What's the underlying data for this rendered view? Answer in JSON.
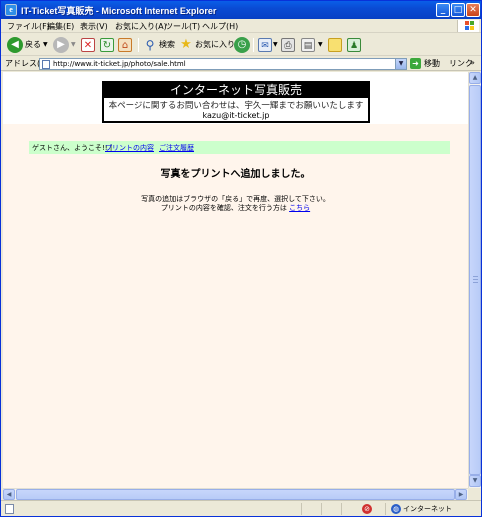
{
  "window": {
    "title": "IT-Ticket写真販売 - Microsoft Internet Explorer",
    "minimize_glyph": "_",
    "maximize_glyph": "□",
    "close_glyph": "✕"
  },
  "menu": {
    "items": [
      "ファイル(F)",
      "編集(E)",
      "表示(V)",
      "お気に入り(A)",
      "ツール(T)",
      "ヘルプ(H)"
    ]
  },
  "toolbar": {
    "back_label": "戻る",
    "search_label": "検索",
    "favorites_label": "お気に入り"
  },
  "address": {
    "label": "アドレス(D)",
    "url": "http://www.it-ticket.jp/photo/sale.html",
    "go_label": "移動",
    "links_label": "リンク",
    "links_chevron": "»"
  },
  "page": {
    "header_title": "インターネット写真販売",
    "header_note": "本ページに関するお問い合わせは、宇久一輝までお願いいたします",
    "header_email": "kazu@it-ticket.jp",
    "nav": {
      "greeting": "ゲストさん、ようこそ!! |",
      "link_print": "プリントの内容",
      "link_history": "ご注文履歴"
    },
    "message_heading": "写真をプリントへ追加しました。",
    "message_line1": "写真の追加はブラウザの「戻る」で再度、選択して下さい。",
    "message_line2_prefix": "プリントの内容を確認、注文を行う方は",
    "message_line2_link": "こちら"
  },
  "status": {
    "zone": "インターネット"
  },
  "colors": {
    "titlebar": "#0a4bd4",
    "content_bg": "#fff5ec",
    "nav_bg": "#ccffcc",
    "link": "#0000ee"
  }
}
